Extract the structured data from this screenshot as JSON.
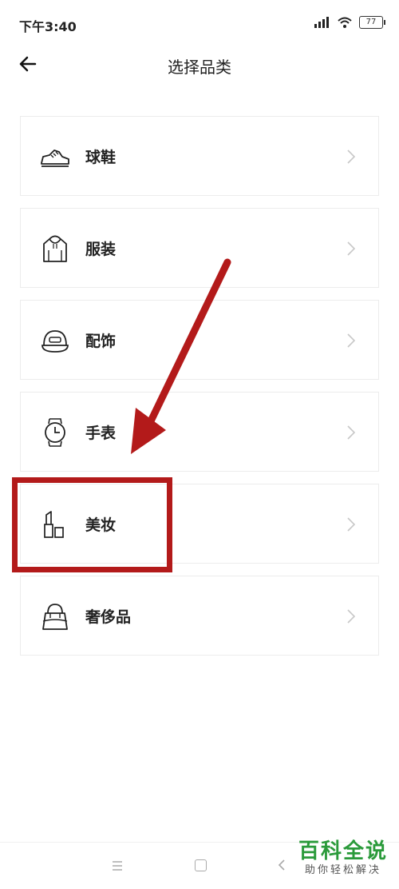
{
  "status_bar": {
    "time": "下午3:40",
    "battery": "77"
  },
  "header": {
    "title": "选择品类"
  },
  "categories": [
    {
      "label": "球鞋",
      "icon": "sneaker-icon"
    },
    {
      "label": "服装",
      "icon": "hoodie-icon"
    },
    {
      "label": "配饰",
      "icon": "cap-icon"
    },
    {
      "label": "手表",
      "icon": "watch-icon"
    },
    {
      "label": "美妆",
      "icon": "lipstick-icon"
    },
    {
      "label": "奢侈品",
      "icon": "handbag-icon"
    }
  ],
  "annotation": {
    "color": "#b31a1a"
  },
  "watermark": {
    "title": "百科全说",
    "subtitle": "助你轻松解决"
  }
}
